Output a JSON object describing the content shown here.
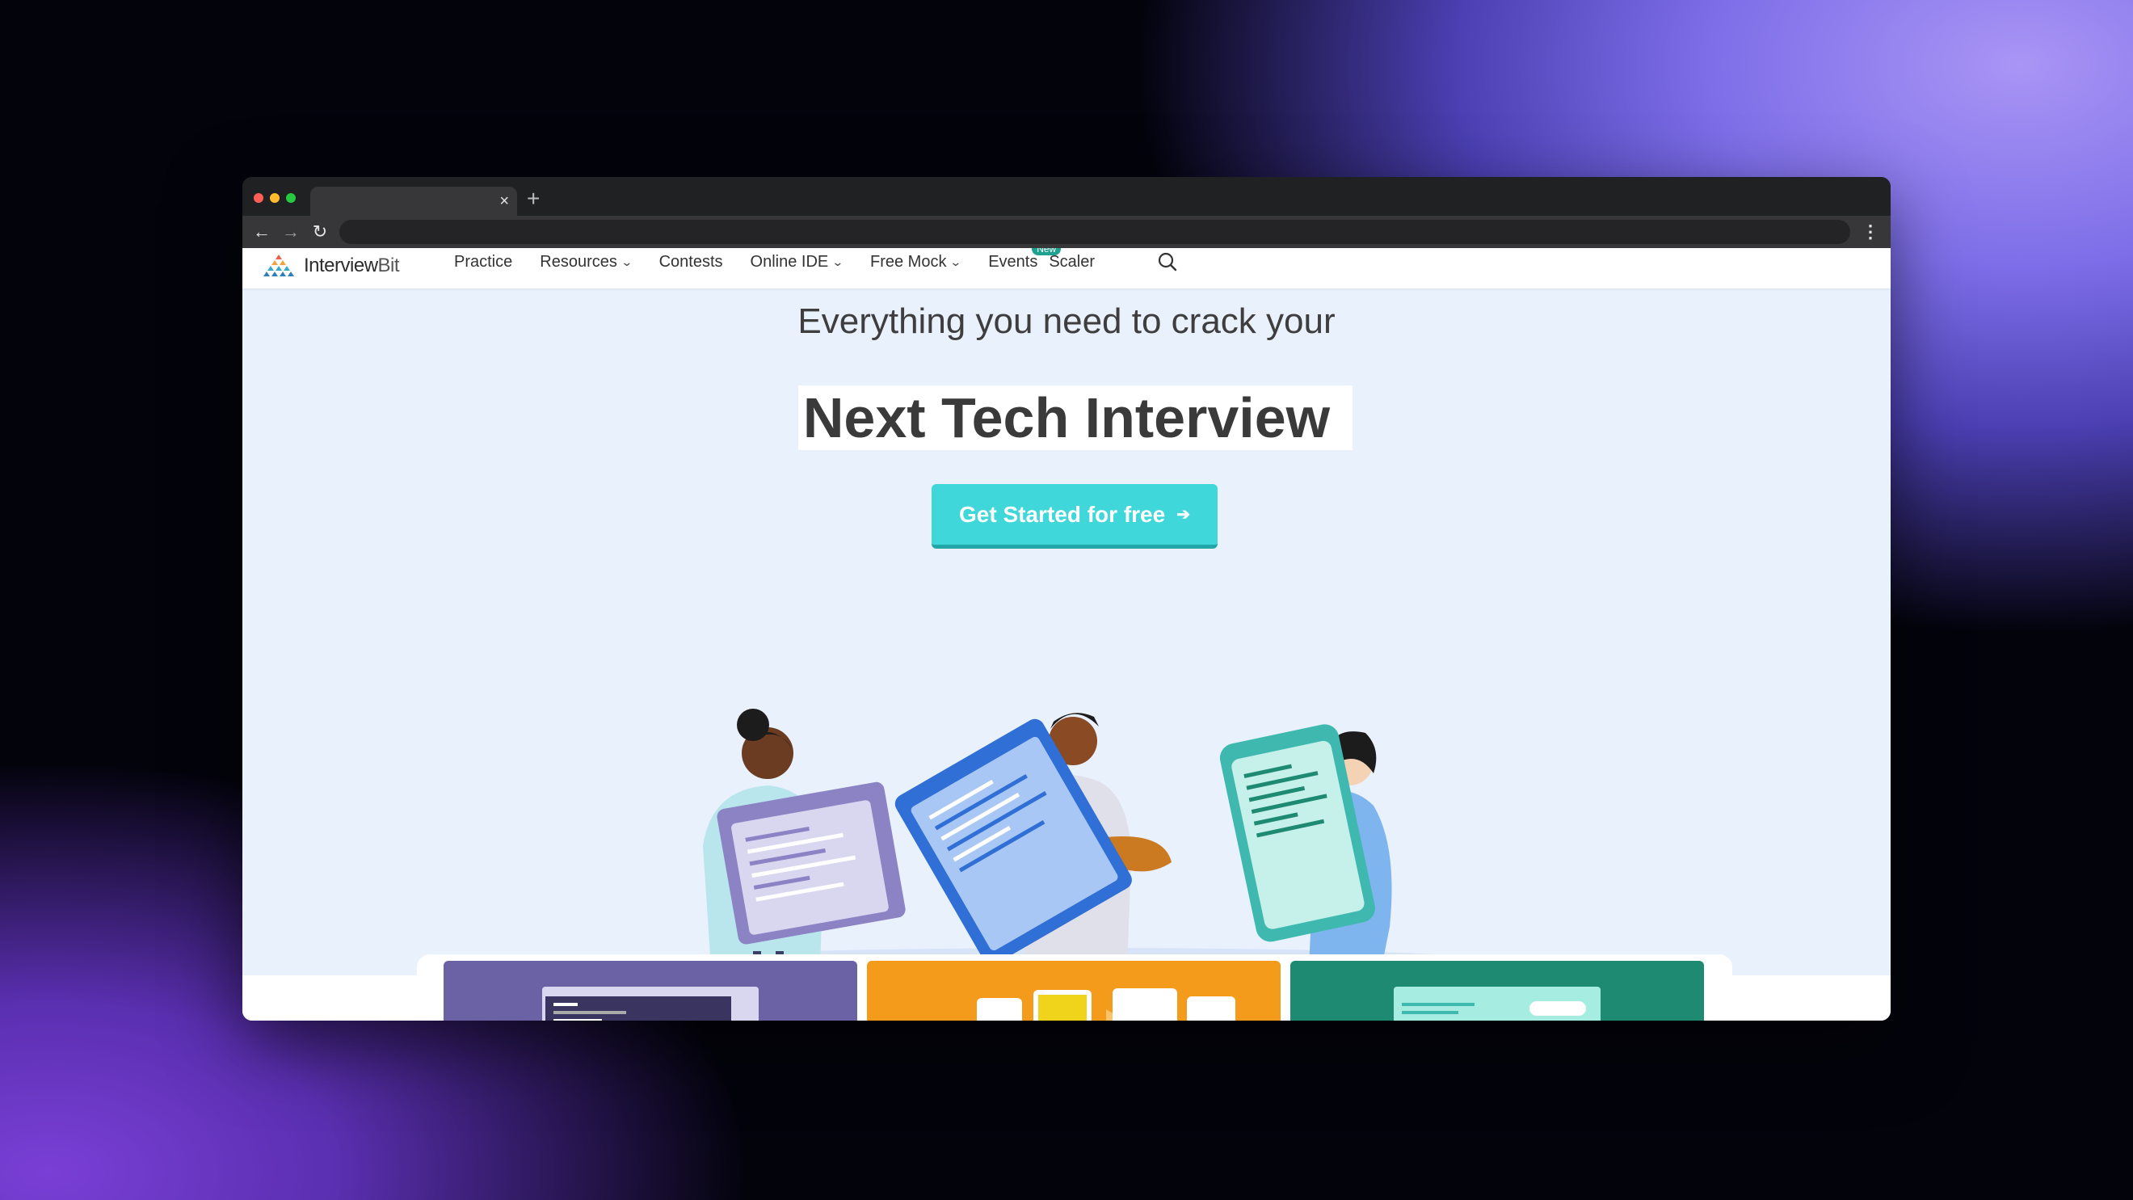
{
  "browser": {
    "tab_close": "×",
    "new_tab": "+",
    "back": "←",
    "forward": "→",
    "reload": "↻",
    "menu": "⋮",
    "traffic_lights": [
      "#ff5f57",
      "#febc2e",
      "#28c840"
    ]
  },
  "site": {
    "logo_text_main": "Interview",
    "logo_text_bit": "Bit",
    "nav": [
      {
        "label": "Practice",
        "dropdown": false
      },
      {
        "label": "Resources",
        "dropdown": true
      },
      {
        "label": "Contests",
        "dropdown": false
      },
      {
        "label": "Online IDE",
        "dropdown": true
      },
      {
        "label": "Free Mock",
        "dropdown": true
      },
      {
        "label": "Events",
        "dropdown": false,
        "badge": "New"
      },
      {
        "label": "Scaler",
        "dropdown": false
      }
    ],
    "chevron": "⌄",
    "search_icon": "search-icon"
  },
  "hero": {
    "subtitle": "Everything you need to crack your",
    "title": "Next Tech Interview",
    "cta_label": "Get Started for free",
    "cta_arrow": "➔"
  },
  "colors": {
    "accent": "#3fd7d9",
    "badge": "#1fa190",
    "hero_bg": "#e9f1fd",
    "card_purple": "#6b62a6",
    "card_orange": "#f59b1b",
    "card_green": "#1e8a72"
  }
}
